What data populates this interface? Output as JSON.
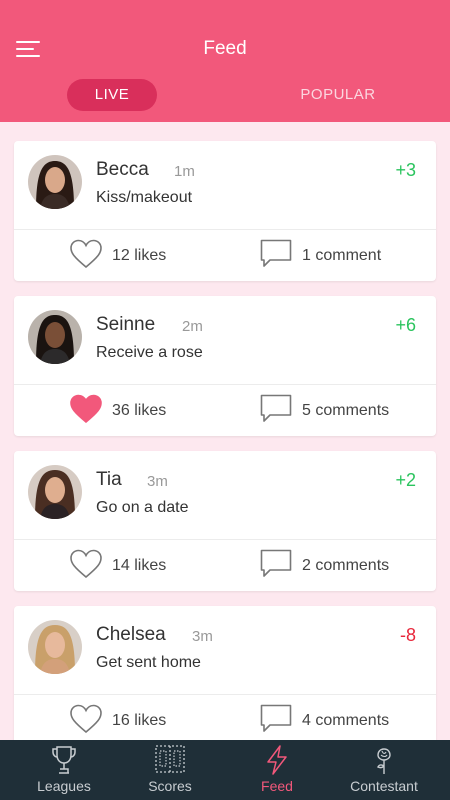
{
  "header": {
    "title": "Feed",
    "tabs": [
      {
        "label": "LIVE",
        "active": true
      },
      {
        "label": "POPULAR",
        "active": false
      }
    ]
  },
  "colors": {
    "brand": "#f2587b",
    "positive": "#2bc45e",
    "negative": "#e8263a",
    "liked_heart": "#f2587b",
    "nav_bg": "#1f2f38"
  },
  "feed": [
    {
      "name": "Becca",
      "time": "1m",
      "action": "Kiss/makeout",
      "points": "+3",
      "points_sign": "positive",
      "likes": "12 likes",
      "liked": false,
      "comments": "1 comment"
    },
    {
      "name": "Seinne",
      "time": "2m",
      "action": "Receive a rose",
      "points": "+6",
      "points_sign": "positive",
      "likes": "36 likes",
      "liked": true,
      "comments": "5 comments"
    },
    {
      "name": "Tia",
      "time": "3m",
      "action": "Go on a date",
      "points": "+2",
      "points_sign": "positive",
      "likes": "14 likes",
      "liked": false,
      "comments": "2 comments"
    },
    {
      "name": "Chelsea",
      "time": "3m",
      "action": "Get sent home",
      "points": "-8",
      "points_sign": "negative",
      "likes": "16 likes",
      "liked": false,
      "comments": "4 comments"
    }
  ],
  "bottom_nav": [
    {
      "label": "Leagues",
      "icon": "trophy-icon",
      "active": false
    },
    {
      "label": "Scores",
      "icon": "scoreboard-icon",
      "active": false
    },
    {
      "label": "Feed",
      "icon": "lightning-icon",
      "active": true
    },
    {
      "label": "Contestant",
      "icon": "rose-icon",
      "active": false
    }
  ]
}
